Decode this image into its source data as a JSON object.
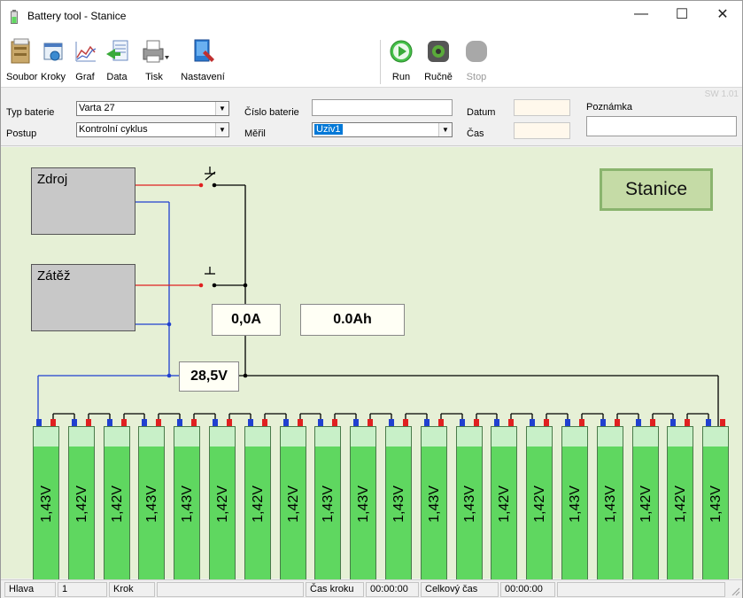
{
  "window": {
    "title": "Battery tool - Stanice",
    "minimize": "—",
    "maximize": "☐",
    "close": "✕"
  },
  "toolbar": {
    "items": [
      {
        "label": "Soubor",
        "icon": "file-cabinet-icon"
      },
      {
        "label": "Kroky",
        "icon": "steps-icon"
      },
      {
        "label": "Graf",
        "icon": "chart-icon"
      },
      {
        "label": "Data",
        "icon": "data-icon"
      },
      {
        "label": "Tisk",
        "icon": "printer-icon"
      },
      {
        "label": "Nastavení",
        "icon": "settings-icon"
      }
    ],
    "run": "Run",
    "manual": "Ručně",
    "stop": "Stop"
  },
  "form": {
    "typ_label": "Typ baterie",
    "typ_value": "Varta 27",
    "postup_label": "Postup",
    "postup_value": "Kontrolní cyklus",
    "cislo_label": "Číslo baterie",
    "cislo_value": "",
    "meril_label": "Měřil",
    "meril_value": "Uziv1",
    "datum_label": "Datum",
    "cas_label": "Čas",
    "poznamka_label": "Poznámka",
    "sw_version": "SW 1.01"
  },
  "diagram": {
    "zdroj": "Zdroj",
    "zatez": "Zátěž",
    "current": "0,0A",
    "charge": "0.0Ah",
    "voltage": "28,5V",
    "station": "Stanice",
    "cells": [
      "1,43V",
      "1,42V",
      "1,42V",
      "1,43V",
      "1,43V",
      "1,42V",
      "1,42V",
      "1,42V",
      "1,43V",
      "1,43V",
      "1,43V",
      "1,43V",
      "1,43V",
      "1,42V",
      "1,42V",
      "1,43V",
      "1,43V",
      "1,42V",
      "1,42V",
      "1,43V"
    ],
    "colors": {
      "background": "#e6f0d6",
      "cell_fill": "#5fd760",
      "wire_red": "#e02020",
      "wire_blue": "#2040d0"
    }
  },
  "status": {
    "hlava": "Hlava",
    "hlava_val": "1",
    "krok": "Krok",
    "cas_kroku": "Čas kroku",
    "cas_kroku_val": "00:00:00",
    "celkovy": "Celkový čas",
    "celkovy_val": "00:00:00"
  }
}
